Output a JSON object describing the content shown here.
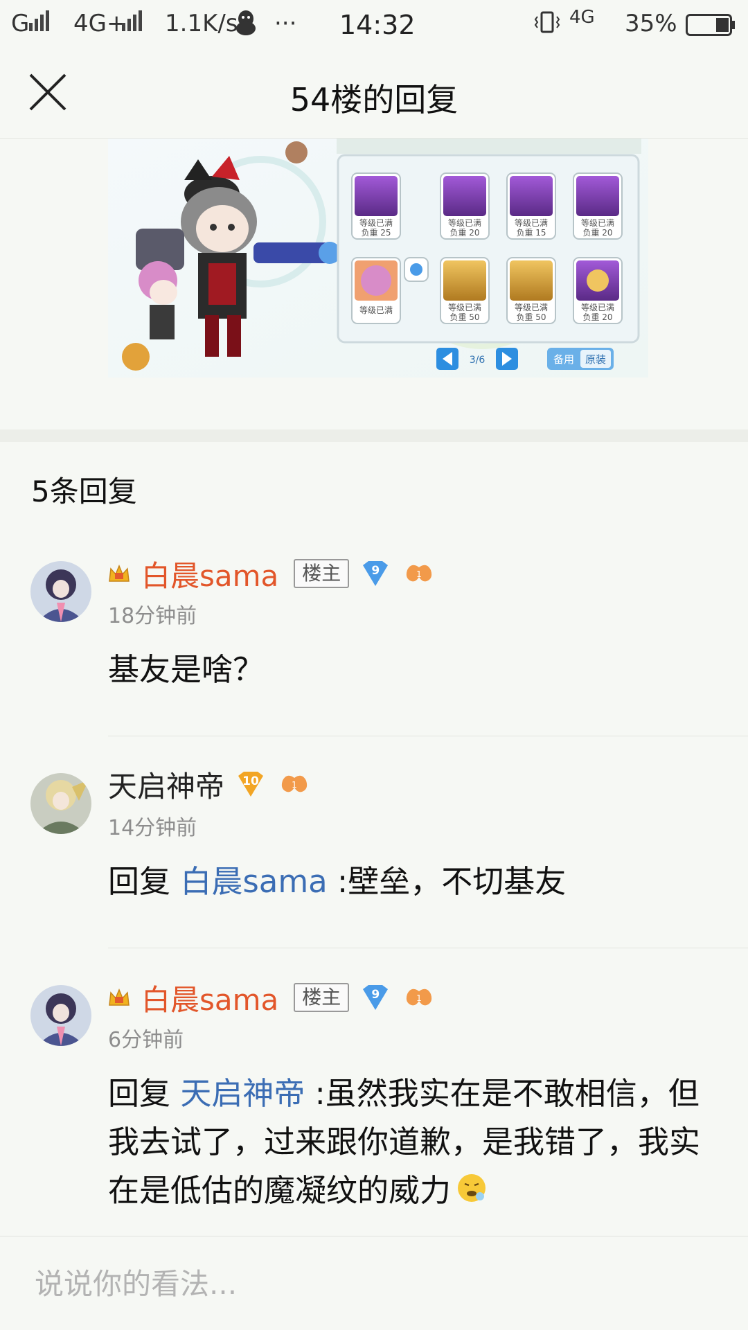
{
  "status_bar": {
    "carrier": "G",
    "network": "4G+",
    "speed": "1.1K/s",
    "dots": "···",
    "time": "14:32",
    "network2": "4G",
    "battery": "35%"
  },
  "nav": {
    "title": "54楼的回复"
  },
  "game_image": {
    "pager": "3/6",
    "btn_spare": "备用",
    "btn_original": "原装",
    "slots": [
      {
        "l1": "等级已满",
        "l2": "负重 25"
      },
      {
        "l1": "等级已满",
        "l2": "负重 20"
      },
      {
        "l1": "等级已满",
        "l2": "负重 15"
      },
      {
        "l1": "等级已满",
        "l2": "负重 20"
      },
      {
        "l1": "等级已满",
        "l2": ""
      },
      {
        "l1": "等级已满",
        "l2": "负重 50"
      },
      {
        "l1": "等级已满",
        "l2": "负重 50"
      },
      {
        "l1": "等级已满",
        "l2": "负重 20"
      }
    ]
  },
  "replies_header": "5条回复",
  "replies": [
    {
      "username": "白晨sama",
      "owner_badge": "楼主",
      "level": "9",
      "time": "18分钟前",
      "prefix": "",
      "mention": "",
      "text": "基友是啥？"
    },
    {
      "username": "天启神帝",
      "owner_badge": "",
      "level": "10",
      "time": "14分钟前",
      "prefix": "回复 ",
      "mention": "白晨sama",
      "text": " :壁垒，不切基友"
    },
    {
      "username": "白晨sama",
      "owner_badge": "楼主",
      "level": "9",
      "time": "6分钟前",
      "prefix": "回复 ",
      "mention": "天启神帝",
      "text": " :虽然我实在是不敢相信，但我去试了，过来跟你道歉，是我错了，我实在是低估的魔凝纹的威力"
    }
  ],
  "comment_bar": {
    "placeholder": "说说你的看法..."
  },
  "colors": {
    "background": "#f6f8f4",
    "owner_name": "#e2562a",
    "mention": "#3b6db4",
    "level9": "#4a9be8",
    "level10": "#f2a524"
  }
}
